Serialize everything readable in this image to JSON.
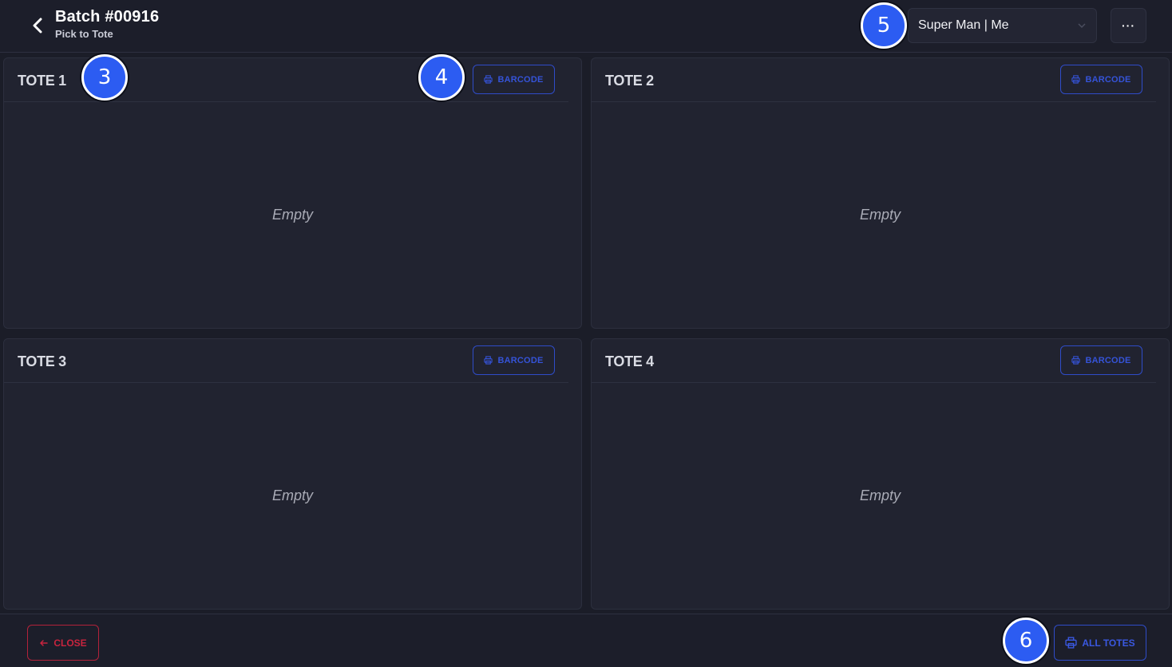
{
  "header": {
    "title": "Batch #00916",
    "subtitle": "Pick to Tote",
    "user_select_value": "Super Man | Me",
    "more_label": "···"
  },
  "totes": [
    {
      "title": "TOTE 1",
      "barcode_label": "BARCODE",
      "empty_label": "Empty"
    },
    {
      "title": "TOTE 2",
      "barcode_label": "BARCODE",
      "empty_label": "Empty"
    },
    {
      "title": "TOTE 3",
      "barcode_label": "BARCODE",
      "empty_label": "Empty"
    },
    {
      "title": "TOTE 4",
      "barcode_label": "BARCODE",
      "empty_label": "Empty"
    }
  ],
  "footer": {
    "close_label": "CLOSE",
    "all_totes_label": "ALL TOTES"
  },
  "markers": [
    "3",
    "4",
    "5",
    "6"
  ],
  "colors": {
    "background": "#1b1d28",
    "panel": "#212330",
    "accent_blue": "#2f4cc8",
    "danger_red": "#c8243e",
    "marker_blue": "#2c5cf2"
  },
  "icons": {
    "back": "chevron-left-icon",
    "dropdown": "chevron-down-icon",
    "more": "ellipsis-icon",
    "barcode": "print-icon",
    "close": "arrow-left-icon",
    "all_totes": "printer-icon"
  }
}
